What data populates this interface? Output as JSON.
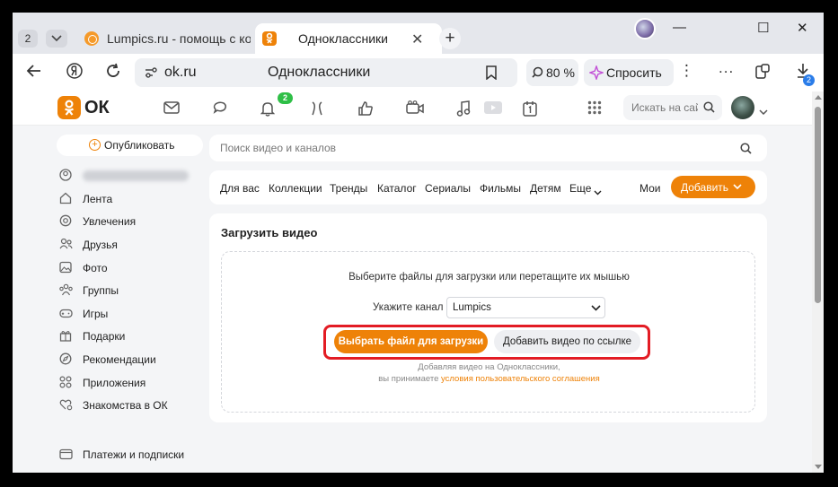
{
  "browser": {
    "tab_count": "2",
    "tabs": [
      {
        "title": "Lumpics.ru - помощь с компьютером"
      },
      {
        "title": "Одноклассники",
        "close": "✕"
      }
    ],
    "new_tab": "+",
    "address": {
      "url": "ok.ru",
      "page_title": "Одноклассники"
    },
    "zoom": "80 %",
    "ask_label": "Спросить",
    "menu_dots": "⋮",
    "more_dots": "...",
    "downloads_badge": "2",
    "window_controls": {
      "minimize": "—",
      "maximize": "☐",
      "close": "✕"
    }
  },
  "header": {
    "logo_text": "ОК",
    "notifications_badge": "2",
    "search_placeholder": "Искать на сайте"
  },
  "sidebar": {
    "publish_label": "Опубликовать",
    "items": [
      {
        "label": "Лента"
      },
      {
        "label": "Увлечения"
      },
      {
        "label": "Друзья"
      },
      {
        "label": "Фото"
      },
      {
        "label": "Группы"
      },
      {
        "label": "Игры"
      },
      {
        "label": "Подарки"
      },
      {
        "label": "Рекомендации"
      },
      {
        "label": "Приложения"
      },
      {
        "label": "Знакомства в ОК"
      },
      {
        "label": "Платежи и подписки"
      }
    ]
  },
  "video": {
    "search_placeholder": "Поиск видео и каналов",
    "nav": [
      "Для вас",
      "Коллекции",
      "Тренды",
      "Каталог",
      "Сериалы",
      "Фильмы",
      "Детям",
      "Еще",
      "Мои"
    ],
    "add_button": "Добавить",
    "upload": {
      "title": "Загрузить видео",
      "hint": "Выберите файлы для загрузки или перетащите их мышью",
      "channel_label": "Укажите канал",
      "channel_value": "Lumpics",
      "pick_file_button": "Выбрать файл для загрузки",
      "add_by_link_button": "Добавить видео по ссылке",
      "legal_line1": "Добавляя видео на Одноклассники,",
      "legal_line2_prefix": "вы принимаете",
      "legal_link": "условия пользовательского соглашения"
    }
  },
  "colors": {
    "accent": "#ee8208",
    "highlight": "#e31c24",
    "badge_green": "#2fbf47"
  }
}
